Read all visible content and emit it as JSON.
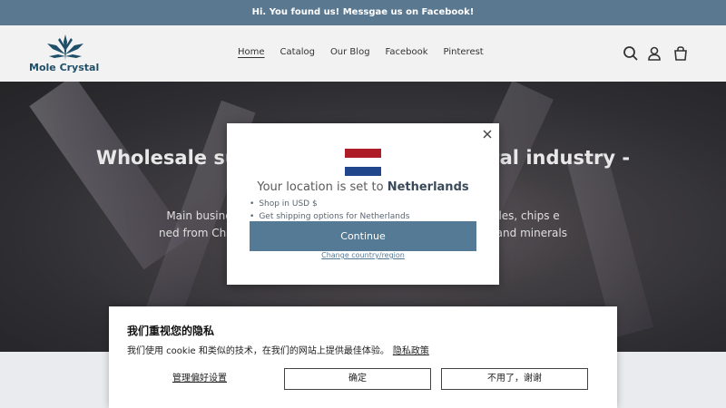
{
  "announcement": {
    "text": "Hi. You found us! Messgae us on Facebook!"
  },
  "header": {
    "logo_text": "Mole Crystal",
    "logo_color": "#1f4e68",
    "nav": [
      {
        "label": "Home",
        "active": true
      },
      {
        "label": "Catalog"
      },
      {
        "label": "Our Blog"
      },
      {
        "label": "Facebook"
      },
      {
        "label": "Pinterest"
      }
    ],
    "icons": [
      "search-icon",
      "account-icon",
      "cart-icon"
    ]
  },
  "hero": {
    "title": "Wholesale su                                      tal industry -",
    "body": "Main busines                                              , freeeforms, tumbles, chips e                                           ned from China; Providing agent                                          ks and minerals"
  },
  "location_modal": {
    "title_prefix": "Your location is set to",
    "country": "Netherlands",
    "bullets": [
      "Shop in USD $",
      "Get shipping options for Netherlands"
    ],
    "continue_label": "Continue",
    "change_label": "Change country/region",
    "flag_colors": [
      "#ae1c28",
      "#ffffff",
      "#21468b"
    ],
    "accent": "#557a95"
  },
  "cookie_banner": {
    "title": "我们重视您的隐私",
    "text": "我们使用 cookie 和类似的技术，在我们的网站上提供最佳体验。",
    "policy_link": "隐私政策",
    "manage_label": "管理偏好设置",
    "accept_label": "确定",
    "decline_label": "不用了，谢谢"
  }
}
